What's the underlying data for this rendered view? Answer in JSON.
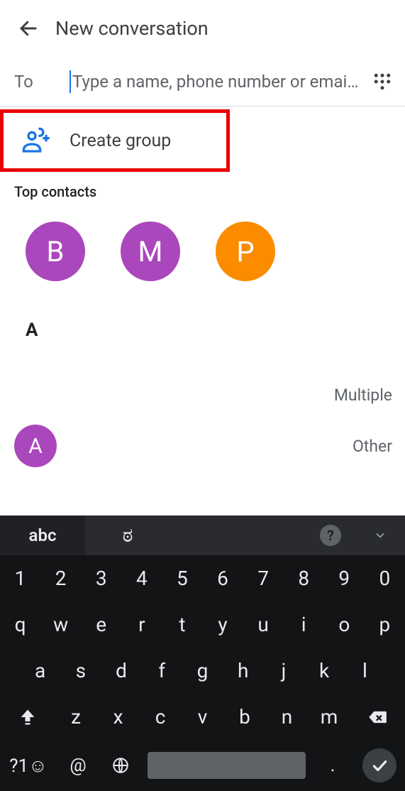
{
  "header": {
    "title": "New conversation"
  },
  "to": {
    "label": "To",
    "placeholder": "Type a name, phone number or email…"
  },
  "create_group": {
    "label": "Create group"
  },
  "top_contacts": {
    "title": "Top contacts",
    "items": [
      {
        "initial": "B",
        "color": "purple"
      },
      {
        "initial": "M",
        "color": "purple"
      },
      {
        "initial": "P",
        "color": "orange"
      }
    ]
  },
  "list": {
    "section": "A",
    "rows": [
      {
        "right": "Multiple"
      },
      {
        "avatar": "A",
        "right": "Other"
      }
    ]
  },
  "keyboard": {
    "tab_label": "abc",
    "lang_glyph": "ಠ",
    "rows": {
      "r1": [
        "1",
        "2",
        "3",
        "4",
        "5",
        "6",
        "7",
        "8",
        "9",
        "0"
      ],
      "r2": [
        "q",
        "w",
        "e",
        "r",
        "t",
        "y",
        "u",
        "i",
        "o",
        "p"
      ],
      "r3": [
        "a",
        "s",
        "d",
        "f",
        "g",
        "h",
        "j",
        "k",
        "l"
      ],
      "r4_mid": [
        "z",
        "x",
        "c",
        "v",
        "b",
        "n",
        "m"
      ]
    },
    "bottom": {
      "sym": "?1☺",
      "at": "@",
      "dot": "."
    }
  }
}
